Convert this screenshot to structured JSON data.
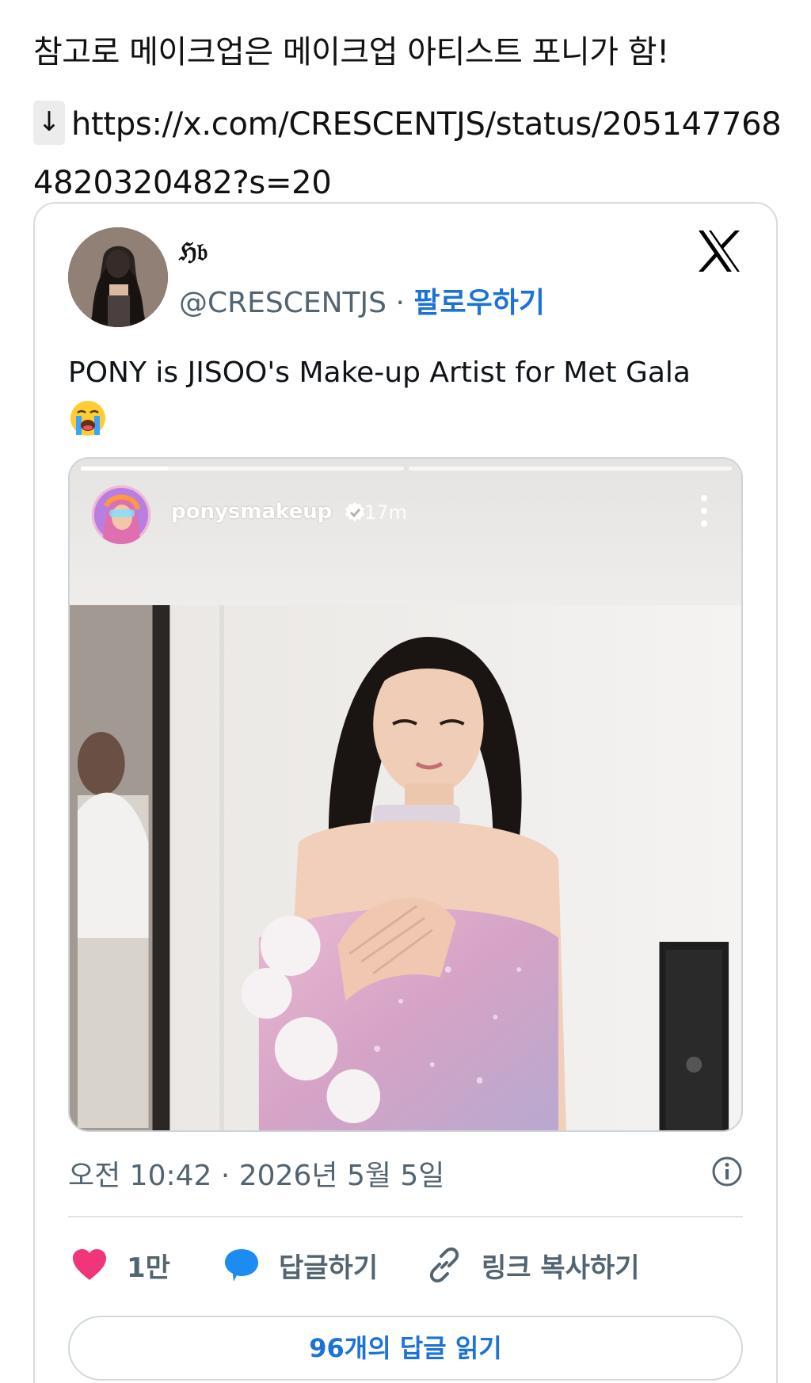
{
  "post": {
    "intro_text": "참고로 메이크업은 메이크업 아티스트 포니가 함!",
    "arrow_glyph": "↓",
    "link_url": "https://x.com/CRESCENTJS/status/2051477684820320482?s=20"
  },
  "embed": {
    "display_name": "ℌ𝔟",
    "handle": "@CRESCENTJS",
    "separator": " · ",
    "follow_label": "팔로우하기",
    "tweet_text": "PONY is JISOO's Make-up Artist for Met Gala ",
    "emoji_icon": "loudly-crying-face-icon",
    "media": {
      "story_username": "ponysmakeup",
      "story_time": "17m",
      "story_progress_fraction": 0.27
    },
    "timestamp": "오전 10:42 · 2026년 5월 5일",
    "actions": {
      "likes_count": "1만",
      "reply_label": "답글하기",
      "copy_link_label": "링크 복사하기"
    },
    "read_replies_label": "96개의 답글 읽기"
  },
  "colors": {
    "accent_blue": "#1d72d8",
    "heart_pink": "#f0357b",
    "secondary_text": "#536471",
    "card_border": "#d6dbe0"
  }
}
